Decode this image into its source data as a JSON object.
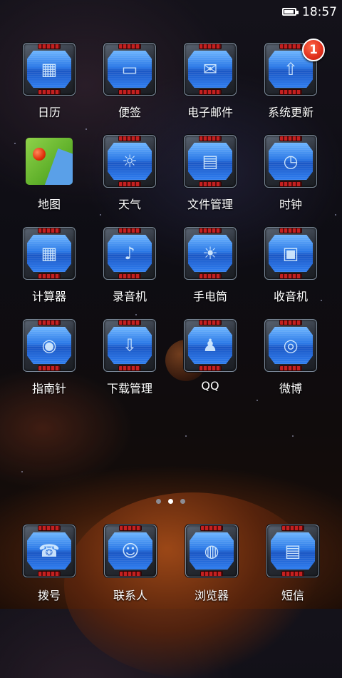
{
  "status_bar": {
    "time": "18:57",
    "battery_level": 0.9
  },
  "apps": [
    {
      "label": "日历",
      "icon": "calendar-icon",
      "glyph": "▦"
    },
    {
      "label": "便签",
      "icon": "notes-icon",
      "glyph": "▭"
    },
    {
      "label": "电子邮件",
      "icon": "mail-icon",
      "glyph": "✉"
    },
    {
      "label": "系统更新",
      "icon": "update-icon",
      "glyph": "⇧",
      "badge": "1"
    },
    {
      "label": "地图",
      "icon": "map-icon",
      "glyph": ""
    },
    {
      "label": "天气",
      "icon": "weather-sun-icon",
      "glyph": "☼"
    },
    {
      "label": "文件管理",
      "icon": "folder-icon",
      "glyph": "▤"
    },
    {
      "label": "时钟",
      "icon": "clock-icon",
      "glyph": "◷"
    },
    {
      "label": "计算器",
      "icon": "calculator-icon",
      "glyph": "▦"
    },
    {
      "label": "录音机",
      "icon": "microphone-icon",
      "glyph": "♪"
    },
    {
      "label": "手电筒",
      "icon": "flashlight-icon",
      "glyph": "☀"
    },
    {
      "label": "收音机",
      "icon": "radio-icon",
      "glyph": "▣"
    },
    {
      "label": "指南针",
      "icon": "compass-icon",
      "glyph": "◉"
    },
    {
      "label": "下载管理",
      "icon": "download-icon",
      "glyph": "⇩"
    },
    {
      "label": "QQ",
      "icon": "qq-penguin-icon",
      "glyph": "♟"
    },
    {
      "label": "微博",
      "icon": "weibo-icon",
      "glyph": "◎"
    }
  ],
  "dock": [
    {
      "label": "拨号",
      "icon": "phone-icon",
      "glyph": "☎"
    },
    {
      "label": "联系人",
      "icon": "contacts-icon",
      "glyph": "☺"
    },
    {
      "label": "浏览器",
      "icon": "browser-globe-icon",
      "glyph": "◍"
    },
    {
      "label": "短信",
      "icon": "message-icon",
      "glyph": "▤"
    }
  ],
  "pager": {
    "pages": 3,
    "current_page": 2
  }
}
